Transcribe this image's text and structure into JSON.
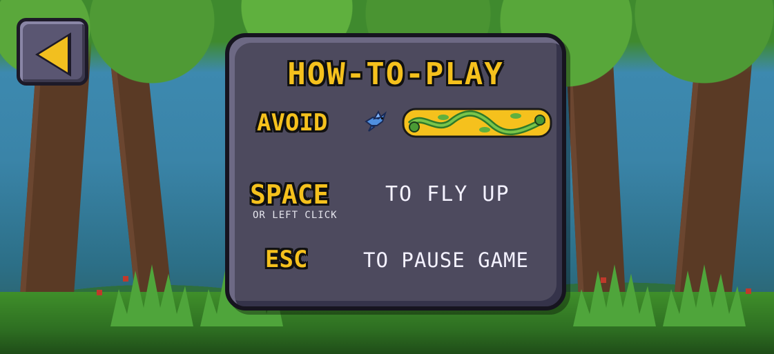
{
  "back_button": {
    "icon": "back-arrow-icon"
  },
  "panel": {
    "title": "HOW-TO-PLAY",
    "avoid": {
      "label": "AVOID",
      "icons": [
        "bird-icon",
        "vine-obstacle-icon"
      ]
    },
    "controls": [
      {
        "key": "SPACE",
        "sub": "OR LEFT CLICK",
        "action": "TO FLY UP"
      },
      {
        "key": "ESC",
        "action": "TO PAUSE GAME"
      }
    ]
  },
  "colors": {
    "accent": "#f5c11d",
    "panel": "#4d4a5e",
    "outline": "#16141f"
  }
}
